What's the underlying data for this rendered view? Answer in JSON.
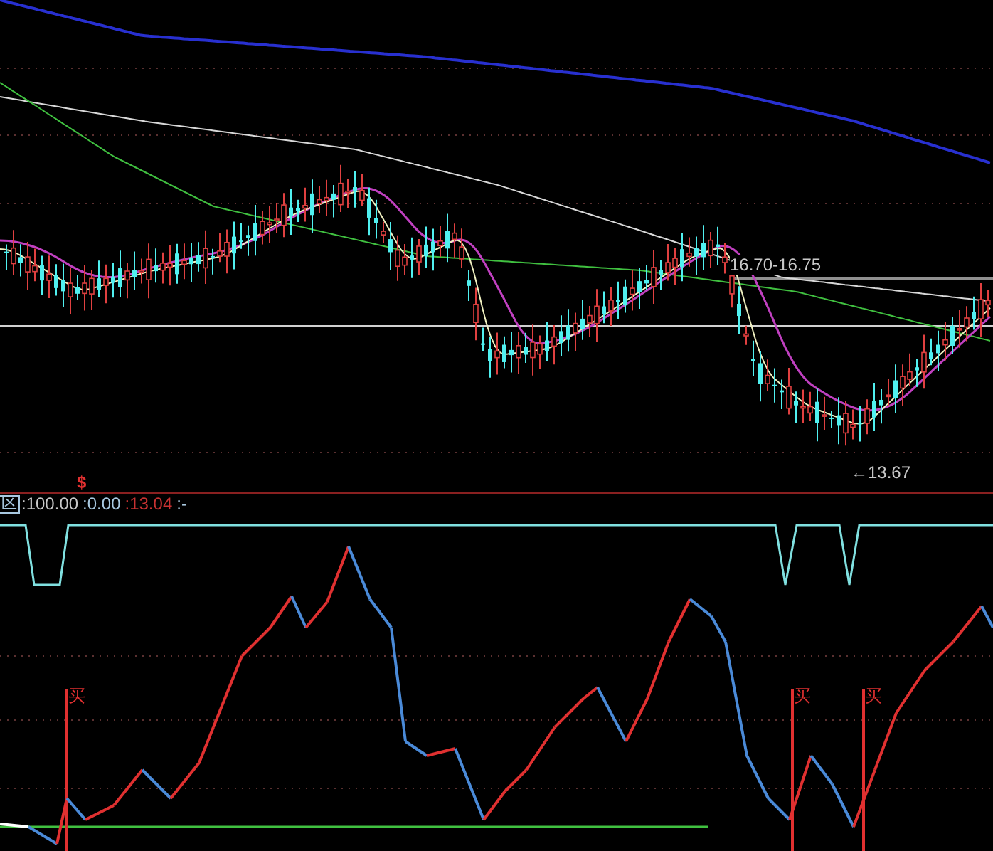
{
  "price_panel": {
    "range_label": "16.70-16.75",
    "low_label": "←13.67",
    "signal_mark": "$"
  },
  "indicator_bar": {
    "name": "区",
    "values": [
      {
        "text": ":100.00",
        "color": "#c8c8c8"
      },
      {
        "text": ":0.00",
        "color": "#a8c8e0"
      },
      {
        "text": ":13.04",
        "color": "#c83232"
      },
      {
        "text": ":-",
        "color": "#a8c8e0"
      }
    ]
  },
  "buy_marks": [
    {
      "label": "买"
    },
    {
      "label": "买"
    },
    {
      "label": "买"
    }
  ]
}
